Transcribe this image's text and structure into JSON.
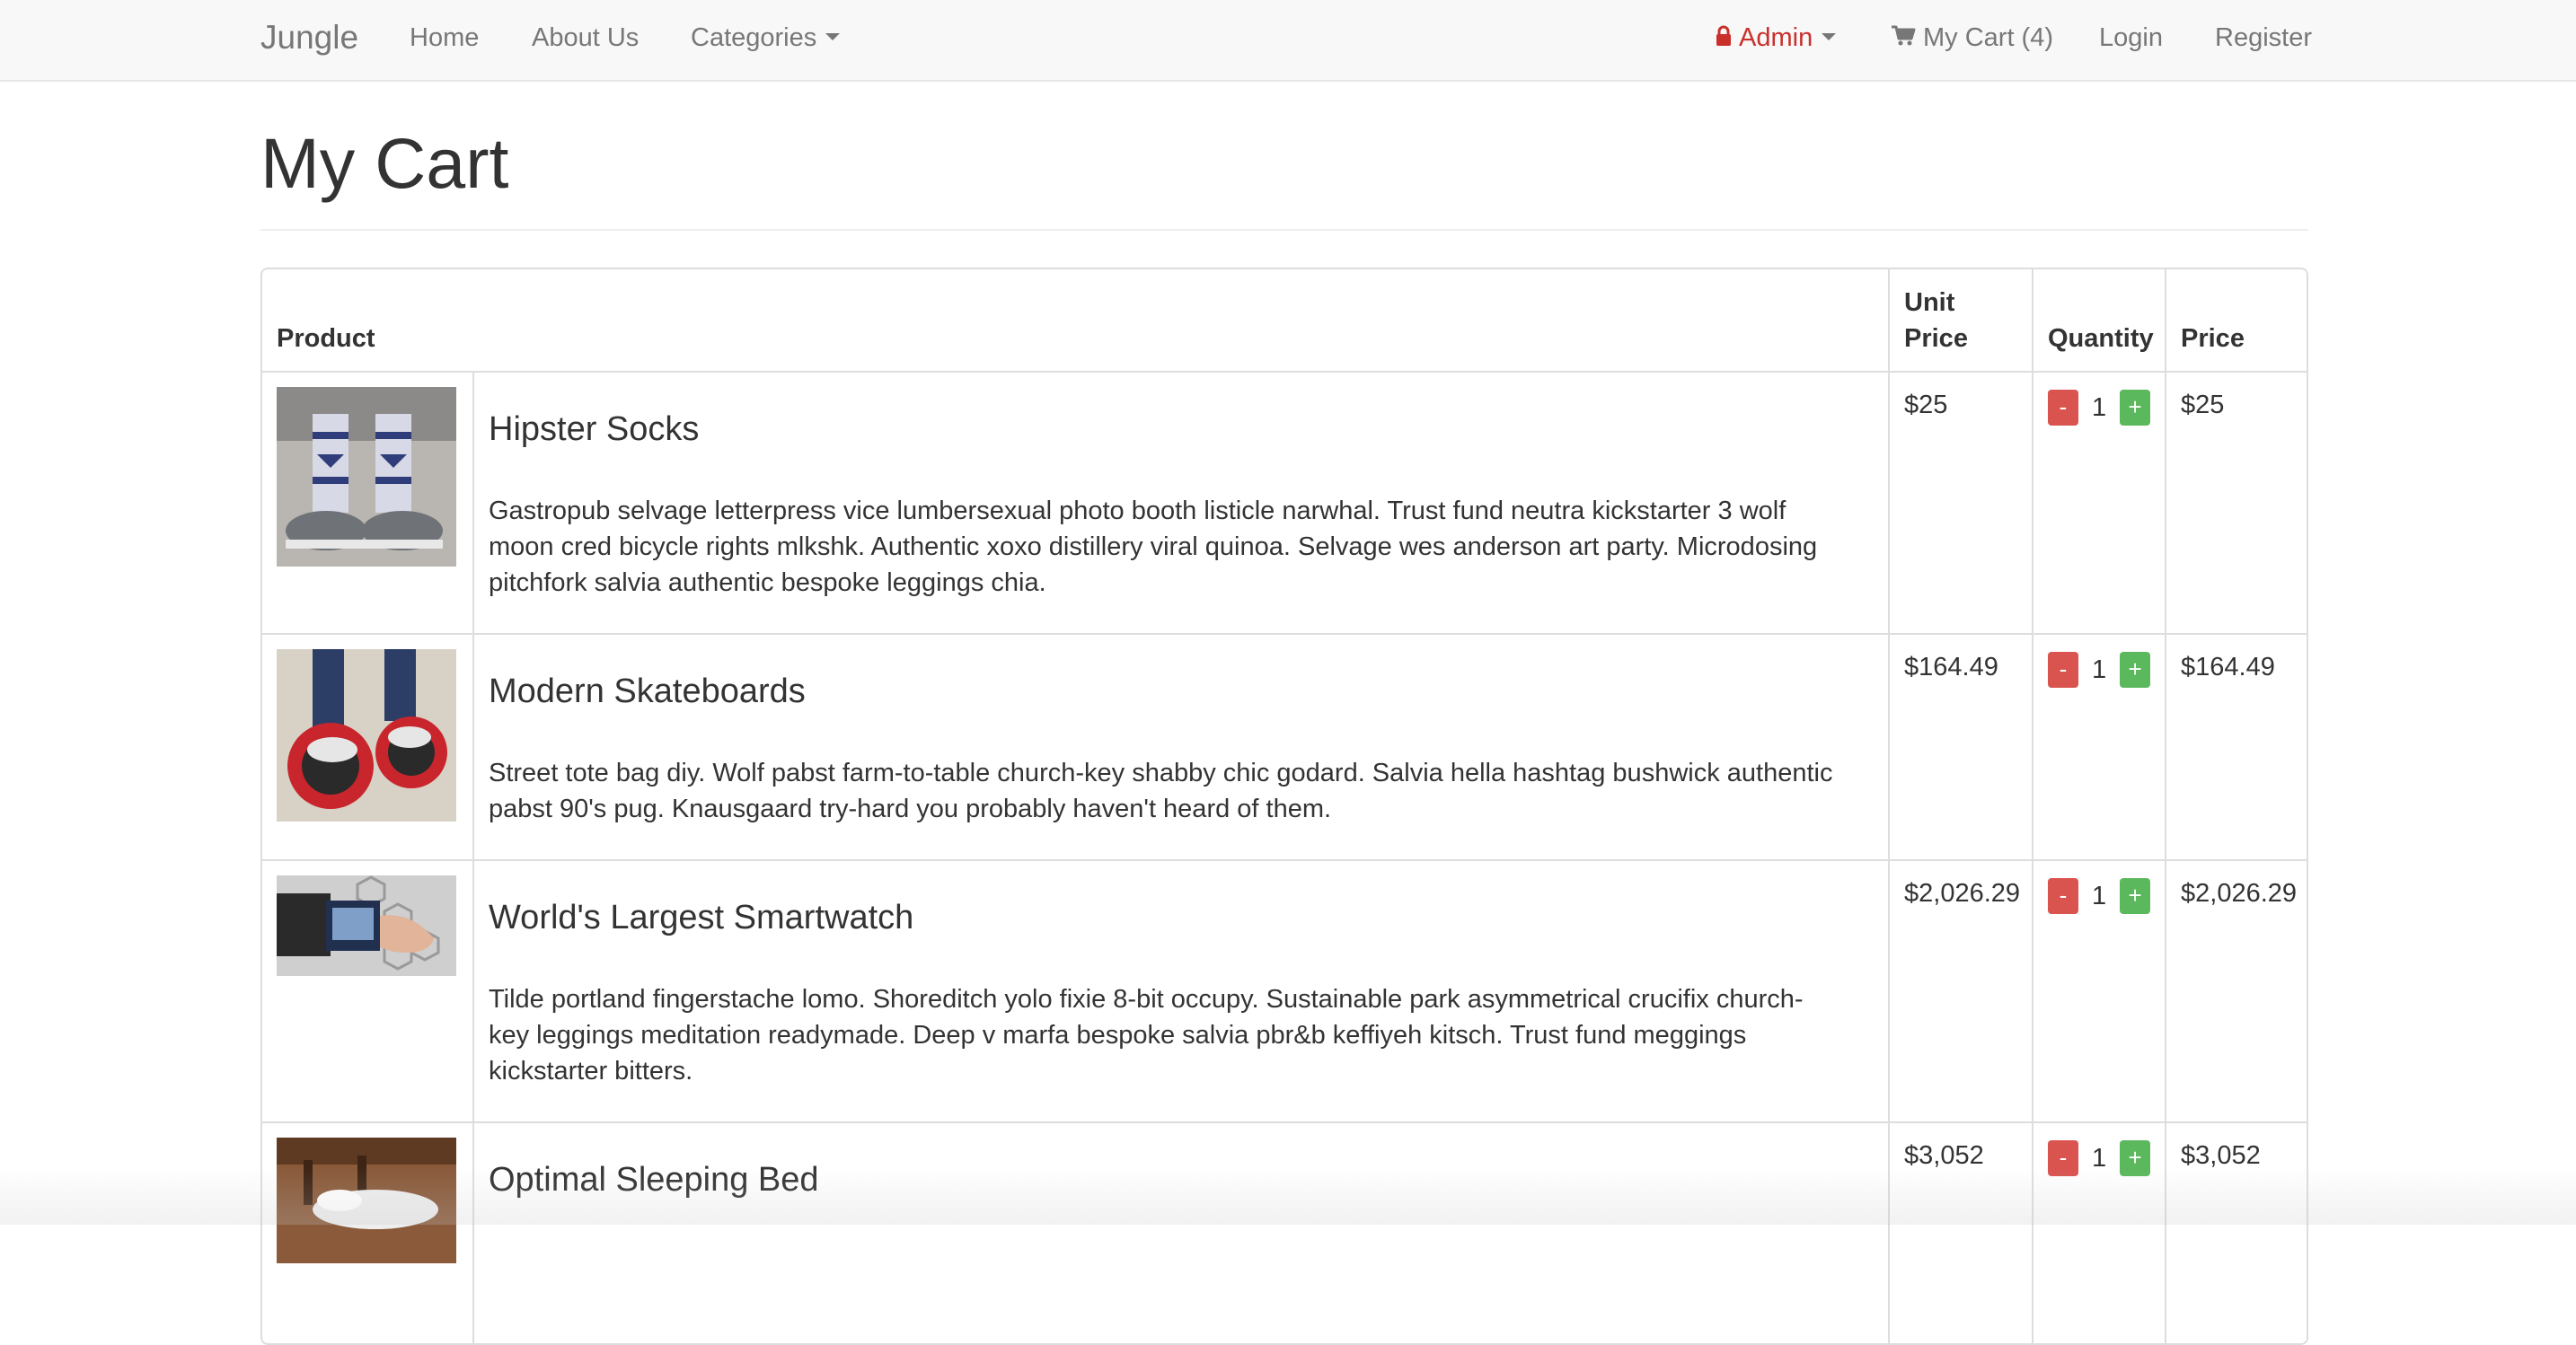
{
  "navbar": {
    "brand": "Jungle",
    "home": "Home",
    "about": "About Us",
    "categories": "Categories",
    "admin": "Admin",
    "cart": "My Cart (4)",
    "login": "Login",
    "register": "Register"
  },
  "page": {
    "title": "My Cart"
  },
  "table": {
    "headers": {
      "product": "Product",
      "unit_price": "Unit Price",
      "quantity": "Quantity",
      "price": "Price"
    },
    "rows": [
      {
        "name": "Hipster Socks",
        "description": "Gastropub selvage letterpress vice lumbersexual photo booth listicle narwhal. Trust fund neutra kickstarter 3 wolf moon cred bicycle rights mlkshk. Authentic xoxo distillery viral quinoa. Selvage wes anderson art party. Microdosing pitchfork salvia authentic bespoke leggings chia.",
        "unit_price": "$25",
        "qty": "1",
        "price": "$25"
      },
      {
        "name": "Modern Skateboards",
        "description": "Street tote bag diy. Wolf pabst farm-to-table church-key shabby chic godard. Salvia hella hashtag bushwick authentic pabst 90's pug. Knausgaard try-hard you probably haven't heard of them.",
        "unit_price": "$164.49",
        "qty": "1",
        "price": "$164.49"
      },
      {
        "name": "World's Largest Smartwatch",
        "description": "Tilde portland fingerstache lomo. Shoreditch yolo fixie 8-bit occupy. Sustainable park asymmetrical crucifix church-key leggings meditation readymade. Deep v marfa bespoke salvia pbr&b keffiyeh kitsch. Trust fund meggings kickstarter bitters.",
        "unit_price": "$2,026.29",
        "qty": "1",
        "price": "$2,026.29"
      },
      {
        "name": "Optimal Sleeping Bed",
        "description": "",
        "unit_price": "$3,052",
        "qty": "1",
        "price": "$3,052"
      }
    ],
    "minus_label": "-",
    "plus_label": "+"
  },
  "colors": {
    "minus": "#d9534f",
    "plus": "#5cb85c",
    "admin": "#c9302c"
  }
}
